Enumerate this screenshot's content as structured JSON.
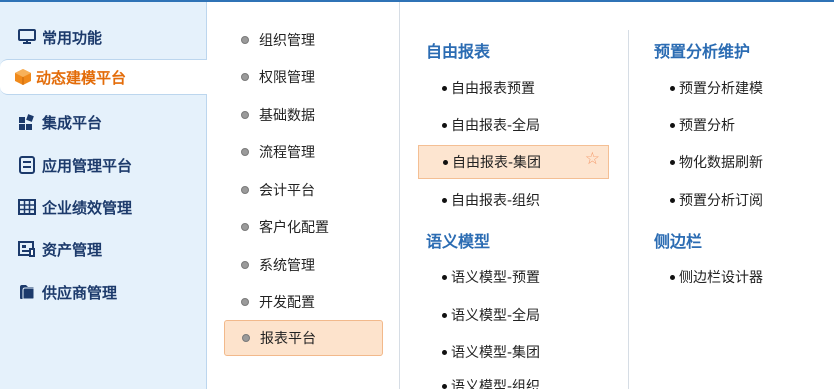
{
  "sidebar": {
    "items": [
      {
        "label": "常用功能",
        "icon": "monitor-icon"
      },
      {
        "label": "动态建模平台",
        "icon": "cube-icon"
      },
      {
        "label": "集成平台",
        "icon": "apps-grid-icon"
      },
      {
        "label": "应用管理平台",
        "icon": "document-list-icon"
      },
      {
        "label": "企业绩效管理",
        "icon": "table-icon"
      },
      {
        "label": "资产管理",
        "icon": "asset-icon"
      },
      {
        "label": "供应商管理",
        "icon": "folder-icon"
      }
    ],
    "active_index": 1
  },
  "middle": {
    "items": [
      {
        "label": "组织管理"
      },
      {
        "label": "权限管理"
      },
      {
        "label": "基础数据"
      },
      {
        "label": "流程管理"
      },
      {
        "label": "会计平台"
      },
      {
        "label": "客户化配置"
      },
      {
        "label": "系统管理"
      },
      {
        "label": "开发配置"
      },
      {
        "label": "报表平台"
      }
    ],
    "active_index": 8
  },
  "panel": {
    "col1": {
      "sections": [
        {
          "title": "自由报表",
          "items": [
            "自由报表预置",
            "自由报表-全局",
            "自由报表-集团",
            "自由报表-组织"
          ]
        },
        {
          "title": "语义模型",
          "items": [
            "语义模型-预置",
            "语义模型-全局",
            "语义模型-集团",
            "语义模型-组织"
          ]
        }
      ]
    },
    "col2": {
      "sections": [
        {
          "title": "预置分析维护",
          "items": [
            "预置分析建模",
            "预置分析",
            "物化数据刷新",
            "预置分析订阅"
          ]
        },
        {
          "title": "侧边栏",
          "items": [
            "侧边栏设计器"
          ]
        }
      ]
    },
    "highlighted": "自由报表-集团"
  },
  "colors": {
    "accent": "#2b6cb3",
    "active_orange": "#e36c09",
    "highlight_bg": "#fde5d0",
    "sidebar_bg": "#e5f1fb"
  }
}
